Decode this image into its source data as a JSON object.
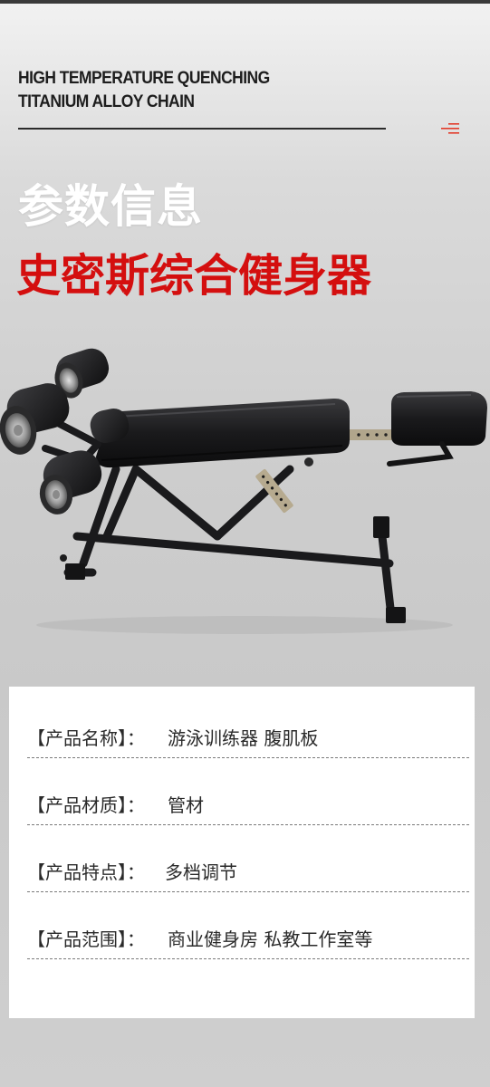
{
  "header": {
    "line1": "HIGH TEMPERATURE QUENCHING",
    "line2": "TITANIUM ALLOY CHAIN"
  },
  "icons": {
    "menu": "menu-icon",
    "accent": "#e23b2a"
  },
  "title": "参数信息",
  "subtitle": "史密斯综合健身器",
  "colors": {
    "title": "#ffffff",
    "subtitle": "#d40f0f"
  },
  "specs": [
    {
      "label": "【产品名称】：",
      "value": "游泳训练器 腹肌板"
    },
    {
      "label": "【产品材质】：",
      "value": "管材"
    },
    {
      "label": "【产品特点】：",
      "value": "多档调节"
    },
    {
      "label": "【产品范围】：",
      "value": "商业健身房  私教工作室等"
    }
  ]
}
